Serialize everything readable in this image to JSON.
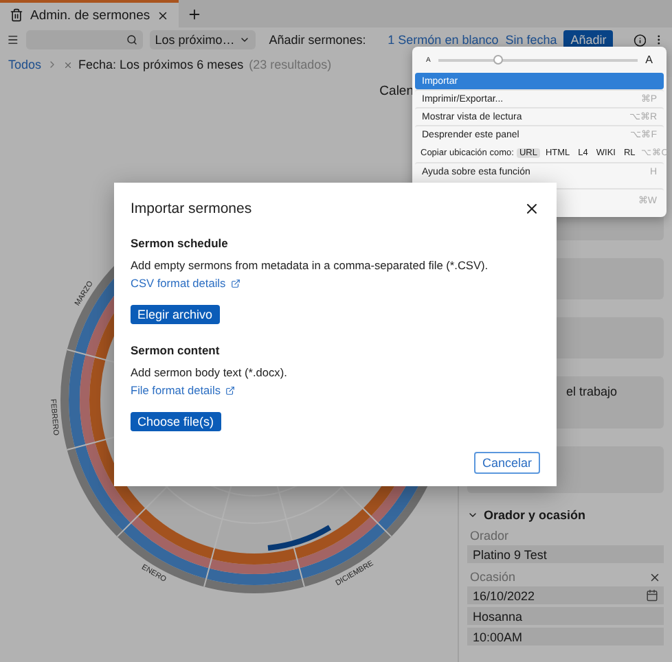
{
  "tabs": [
    {
      "label": "Admin. de sermones",
      "selected": true
    }
  ],
  "toolbar": {
    "filter_select": "Los próximo…",
    "add_label": "Añadir sermones:",
    "add_links": [
      "1 Sermón en blanco",
      "Sin fecha"
    ],
    "add_button": "Añadir"
  },
  "breadcrumb": {
    "root": "Todos",
    "filter": "Fecha: Los próximos 6 meses",
    "count": "(23 resultados)"
  },
  "view_label": "Calen",
  "calendar": {
    "months": [
      "MARZO",
      "FEBRERO",
      "ENERO",
      "DICIEMBRE"
    ]
  },
  "menu": {
    "text_size": {
      "small": "A",
      "large": "A",
      "level": 0.3
    },
    "items": [
      {
        "kind": "item",
        "label": "Importar",
        "selected": true
      },
      {
        "kind": "item",
        "label": "Imprimir/Exportar...",
        "shortcut": "⌘P",
        "selected": false
      },
      {
        "kind": "item",
        "label": "Mostrar vista de lectura",
        "shortcut": "⌥⌘R",
        "selected": false
      },
      {
        "kind": "item",
        "label": "Desprender este panel",
        "shortcut": "⌥⌘F",
        "selected": false
      },
      {
        "kind": "copy",
        "label": "Copiar ubicación como:",
        "options": [
          {
            "label": "URL",
            "selected": true
          },
          {
            "label": "HTML",
            "selected": false
          },
          {
            "label": "L4",
            "selected": false
          },
          {
            "label": "WIKI",
            "selected": false
          },
          {
            "label": "RL",
            "selected": false
          }
        ],
        "shortcut": "⌥⌘C"
      },
      {
        "kind": "item",
        "label": "Ayuda sobre esta función",
        "shortcut": "H",
        "selected": false
      },
      {
        "kind": "item",
        "shortcut": "⌘W",
        "selected": false
      }
    ]
  },
  "side_panel": {
    "note": "el trabajo",
    "section": {
      "title": "Orador y ocasión",
      "expanded": true,
      "fields": [
        {
          "label": "Orador",
          "clearable": false,
          "values": [
            "Platino 9 Test"
          ]
        },
        {
          "label": "Ocasión",
          "clearable": true,
          "values": [
            "16/10/2022",
            "Hosanna",
            "10:00AM"
          ]
        }
      ]
    }
  },
  "dialog": {
    "title": "Importar sermones",
    "sections": [
      {
        "heading": "Sermon schedule",
        "text": "Add empty sermons from metadata in a comma-separated file (*.CSV).",
        "link": "CSV format details",
        "button": "Elegir archivo"
      },
      {
        "heading": "Sermon content",
        "text": "Add sermon body text (*.docx).",
        "link": "File format details",
        "button": "Choose file(s)"
      }
    ],
    "cancel": "Cancelar"
  }
}
